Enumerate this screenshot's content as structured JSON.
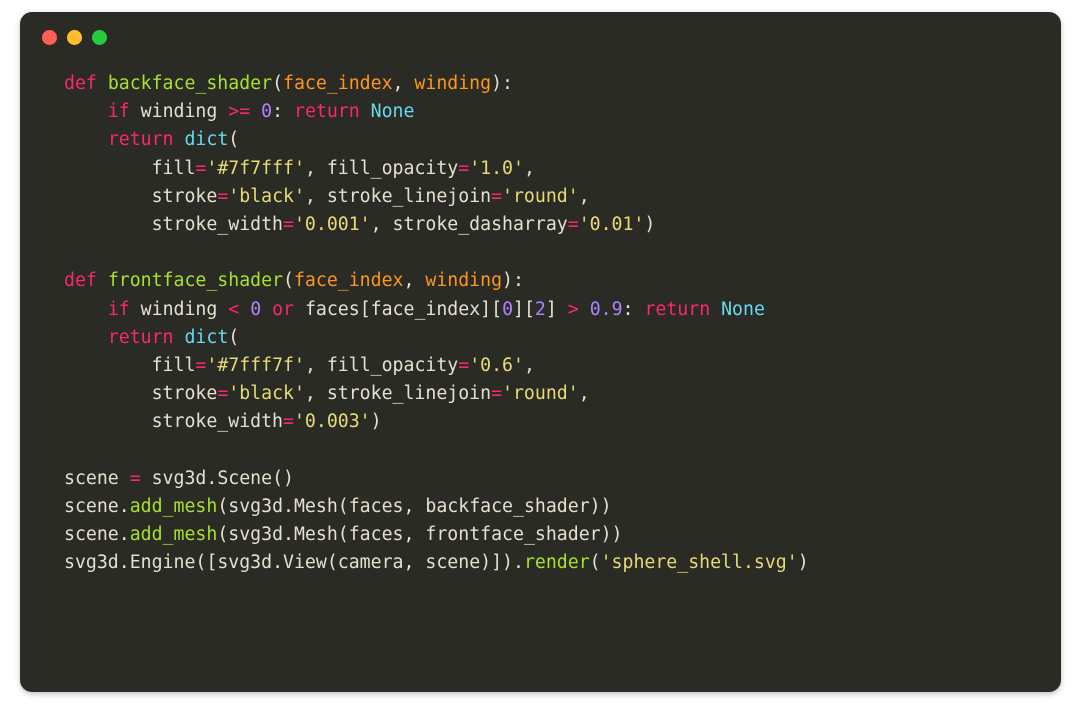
{
  "window": {
    "traffic": {
      "red": "#ff5f56",
      "yellow": "#ffbd2e",
      "green": "#27c93f"
    }
  },
  "code": {
    "lines": [
      [
        {
          "t": "def ",
          "c": "kw"
        },
        {
          "t": "backface_shader",
          "c": "fn"
        },
        {
          "t": "(",
          "c": "pun"
        },
        {
          "t": "face_index",
          "c": "param"
        },
        {
          "t": ", ",
          "c": "pun"
        },
        {
          "t": "winding",
          "c": "param"
        },
        {
          "t": ")",
          "c": "pun"
        },
        {
          "t": ":",
          "c": "pun"
        }
      ],
      [
        {
          "t": "    ",
          "c": "pun"
        },
        {
          "t": "if ",
          "c": "kw"
        },
        {
          "t": "winding ",
          "c": "id"
        },
        {
          "t": ">= ",
          "c": "op"
        },
        {
          "t": "0",
          "c": "num"
        },
        {
          "t": ": ",
          "c": "pun"
        },
        {
          "t": "return ",
          "c": "kw"
        },
        {
          "t": "None",
          "c": "const"
        }
      ],
      [
        {
          "t": "    ",
          "c": "pun"
        },
        {
          "t": "return ",
          "c": "kw"
        },
        {
          "t": "dict",
          "c": "builtin"
        },
        {
          "t": "(",
          "c": "pun"
        }
      ],
      [
        {
          "t": "        ",
          "c": "pun"
        },
        {
          "t": "fill",
          "c": "id"
        },
        {
          "t": "=",
          "c": "op"
        },
        {
          "t": "'#7f7fff'",
          "c": "str"
        },
        {
          "t": ", ",
          "c": "pun"
        },
        {
          "t": "fill_opacity",
          "c": "id"
        },
        {
          "t": "=",
          "c": "op"
        },
        {
          "t": "'1.0'",
          "c": "str"
        },
        {
          "t": ",",
          "c": "pun"
        }
      ],
      [
        {
          "t": "        ",
          "c": "pun"
        },
        {
          "t": "stroke",
          "c": "id"
        },
        {
          "t": "=",
          "c": "op"
        },
        {
          "t": "'black'",
          "c": "str"
        },
        {
          "t": ", ",
          "c": "pun"
        },
        {
          "t": "stroke_linejoin",
          "c": "id"
        },
        {
          "t": "=",
          "c": "op"
        },
        {
          "t": "'round'",
          "c": "str"
        },
        {
          "t": ",",
          "c": "pun"
        }
      ],
      [
        {
          "t": "        ",
          "c": "pun"
        },
        {
          "t": "stroke_width",
          "c": "id"
        },
        {
          "t": "=",
          "c": "op"
        },
        {
          "t": "'0.001'",
          "c": "str"
        },
        {
          "t": ", ",
          "c": "pun"
        },
        {
          "t": "stroke_dasharray",
          "c": "id"
        },
        {
          "t": "=",
          "c": "op"
        },
        {
          "t": "'0.01'",
          "c": "str"
        },
        {
          "t": ")",
          "c": "pun"
        }
      ],
      [],
      [
        {
          "t": "def ",
          "c": "kw"
        },
        {
          "t": "frontface_shader",
          "c": "fn"
        },
        {
          "t": "(",
          "c": "pun"
        },
        {
          "t": "face_index",
          "c": "param"
        },
        {
          "t": ", ",
          "c": "pun"
        },
        {
          "t": "winding",
          "c": "param"
        },
        {
          "t": ")",
          "c": "pun"
        },
        {
          "t": ":",
          "c": "pun"
        }
      ],
      [
        {
          "t": "    ",
          "c": "pun"
        },
        {
          "t": "if ",
          "c": "kw"
        },
        {
          "t": "winding ",
          "c": "id"
        },
        {
          "t": "< ",
          "c": "op"
        },
        {
          "t": "0",
          "c": "num"
        },
        {
          "t": " ",
          "c": "pun"
        },
        {
          "t": "or ",
          "c": "kw"
        },
        {
          "t": "faces",
          "c": "id"
        },
        {
          "t": "[",
          "c": "pun"
        },
        {
          "t": "face_index",
          "c": "id"
        },
        {
          "t": "][",
          "c": "pun"
        },
        {
          "t": "0",
          "c": "num"
        },
        {
          "t": "][",
          "c": "pun"
        },
        {
          "t": "2",
          "c": "num"
        },
        {
          "t": "] ",
          "c": "pun"
        },
        {
          "t": "> ",
          "c": "op"
        },
        {
          "t": "0.9",
          "c": "num"
        },
        {
          "t": ": ",
          "c": "pun"
        },
        {
          "t": "return ",
          "c": "kw"
        },
        {
          "t": "None",
          "c": "const"
        }
      ],
      [
        {
          "t": "    ",
          "c": "pun"
        },
        {
          "t": "return ",
          "c": "kw"
        },
        {
          "t": "dict",
          "c": "builtin"
        },
        {
          "t": "(",
          "c": "pun"
        }
      ],
      [
        {
          "t": "        ",
          "c": "pun"
        },
        {
          "t": "fill",
          "c": "id"
        },
        {
          "t": "=",
          "c": "op"
        },
        {
          "t": "'#7fff7f'",
          "c": "str"
        },
        {
          "t": ", ",
          "c": "pun"
        },
        {
          "t": "fill_opacity",
          "c": "id"
        },
        {
          "t": "=",
          "c": "op"
        },
        {
          "t": "'0.6'",
          "c": "str"
        },
        {
          "t": ",",
          "c": "pun"
        }
      ],
      [
        {
          "t": "        ",
          "c": "pun"
        },
        {
          "t": "stroke",
          "c": "id"
        },
        {
          "t": "=",
          "c": "op"
        },
        {
          "t": "'black'",
          "c": "str"
        },
        {
          "t": ", ",
          "c": "pun"
        },
        {
          "t": "stroke_linejoin",
          "c": "id"
        },
        {
          "t": "=",
          "c": "op"
        },
        {
          "t": "'round'",
          "c": "str"
        },
        {
          "t": ",",
          "c": "pun"
        }
      ],
      [
        {
          "t": "        ",
          "c": "pun"
        },
        {
          "t": "stroke_width",
          "c": "id"
        },
        {
          "t": "=",
          "c": "op"
        },
        {
          "t": "'0.003'",
          "c": "str"
        },
        {
          "t": ")",
          "c": "pun"
        }
      ],
      [],
      [
        {
          "t": "scene ",
          "c": "id"
        },
        {
          "t": "= ",
          "c": "op"
        },
        {
          "t": "svg3d",
          "c": "id"
        },
        {
          "t": ".",
          "c": "pun"
        },
        {
          "t": "Scene",
          "c": "id"
        },
        {
          "t": "()",
          "c": "pun"
        }
      ],
      [
        {
          "t": "scene",
          "c": "id"
        },
        {
          "t": ".",
          "c": "pun"
        },
        {
          "t": "add_mesh",
          "c": "fn"
        },
        {
          "t": "(",
          "c": "pun"
        },
        {
          "t": "svg3d",
          "c": "id"
        },
        {
          "t": ".",
          "c": "pun"
        },
        {
          "t": "Mesh",
          "c": "id"
        },
        {
          "t": "(",
          "c": "pun"
        },
        {
          "t": "faces",
          "c": "id"
        },
        {
          "t": ", ",
          "c": "pun"
        },
        {
          "t": "backface_shader",
          "c": "id"
        },
        {
          "t": "))",
          "c": "pun"
        }
      ],
      [
        {
          "t": "scene",
          "c": "id"
        },
        {
          "t": ".",
          "c": "pun"
        },
        {
          "t": "add_mesh",
          "c": "fn"
        },
        {
          "t": "(",
          "c": "pun"
        },
        {
          "t": "svg3d",
          "c": "id"
        },
        {
          "t": ".",
          "c": "pun"
        },
        {
          "t": "Mesh",
          "c": "id"
        },
        {
          "t": "(",
          "c": "pun"
        },
        {
          "t": "faces",
          "c": "id"
        },
        {
          "t": ", ",
          "c": "pun"
        },
        {
          "t": "frontface_shader",
          "c": "id"
        },
        {
          "t": "))",
          "c": "pun"
        }
      ],
      [
        {
          "t": "svg3d",
          "c": "id"
        },
        {
          "t": ".",
          "c": "pun"
        },
        {
          "t": "Engine",
          "c": "id"
        },
        {
          "t": "([",
          "c": "pun"
        },
        {
          "t": "svg3d",
          "c": "id"
        },
        {
          "t": ".",
          "c": "pun"
        },
        {
          "t": "View",
          "c": "id"
        },
        {
          "t": "(",
          "c": "pun"
        },
        {
          "t": "camera",
          "c": "id"
        },
        {
          "t": ", ",
          "c": "pun"
        },
        {
          "t": "scene",
          "c": "id"
        },
        {
          "t": ")])",
          "c": "pun"
        },
        {
          "t": ".",
          "c": "pun"
        },
        {
          "t": "render",
          "c": "fn"
        },
        {
          "t": "(",
          "c": "pun"
        },
        {
          "t": "'sphere_shell.svg'",
          "c": "str"
        },
        {
          "t": ")",
          "c": "pun"
        }
      ]
    ]
  }
}
